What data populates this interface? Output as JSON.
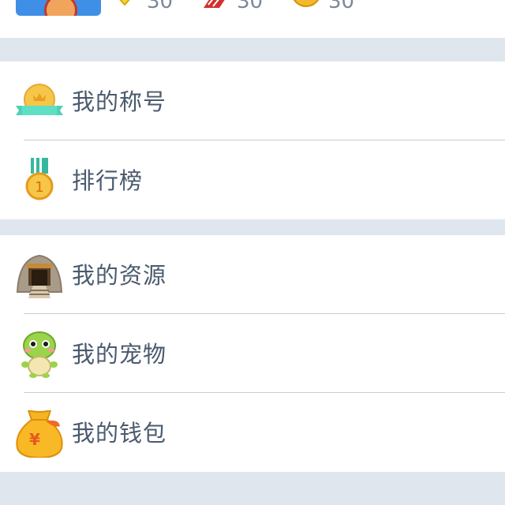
{
  "stats": [
    {
      "icon": "diamond-icon",
      "value": "30"
    },
    {
      "icon": "meat-icon",
      "value": "30"
    },
    {
      "icon": "coin-icon",
      "value": "30"
    }
  ],
  "menu": {
    "section1": [
      {
        "icon": "title-badge-icon",
        "label": "我的称号"
      },
      {
        "icon": "medal-icon",
        "label": "排行榜"
      }
    ],
    "section2": [
      {
        "icon": "mine-icon",
        "label": "我的资源"
      },
      {
        "icon": "turtle-pet-icon",
        "label": "我的宠物"
      },
      {
        "icon": "money-bag-icon",
        "label": "我的钱包"
      }
    ]
  },
  "colors": {
    "background": "#dfe6ee",
    "card": "#ffffff",
    "text": "#4a5a6e",
    "stat_text": "#7a889a",
    "divider": "#c9ced6"
  }
}
